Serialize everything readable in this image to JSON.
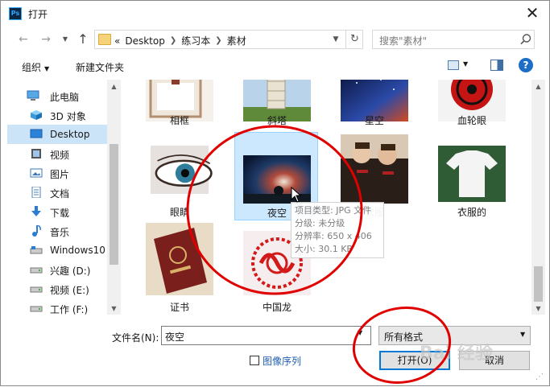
{
  "window": {
    "app_icon_label": "Ps",
    "title": "打开",
    "close_glyph": "✕"
  },
  "nav": {
    "back_glyph": "←",
    "forward_glyph": "→",
    "up_glyph": "↑",
    "breadcrumb_prefix": "«",
    "breadcrumbs": [
      "Desktop",
      "练习本",
      "素材"
    ],
    "refresh_glyph": "↻",
    "search_placeholder": "搜索\"素材\""
  },
  "toolbar": {
    "organize_label": "组织",
    "new_folder_label": "新建文件夹",
    "help_label": "?"
  },
  "sidebar": {
    "items": [
      {
        "label": "此电脑",
        "icon": "computer-icon"
      },
      {
        "label": "3D 对象",
        "icon": "3d-objects-icon"
      },
      {
        "label": "Desktop",
        "icon": "desktop-icon",
        "selected": true
      },
      {
        "label": "视频",
        "icon": "video-icon"
      },
      {
        "label": "图片",
        "icon": "pictures-icon"
      },
      {
        "label": "文档",
        "icon": "documents-icon"
      },
      {
        "label": "下载",
        "icon": "download-icon"
      },
      {
        "label": "音乐",
        "icon": "music-icon"
      },
      {
        "label": "Windows10",
        "icon": "drive-icon"
      },
      {
        "label": "兴趣 (D:)",
        "icon": "drive-icon"
      },
      {
        "label": "视频 (E:)",
        "icon": "drive-icon"
      },
      {
        "label": "工作 (F:)",
        "icon": "drive-icon"
      }
    ]
  },
  "files": [
    {
      "name": "相框"
    },
    {
      "name": "斜塔"
    },
    {
      "name": "星空"
    },
    {
      "name": "血轮眼"
    },
    {
      "name": "眼睛"
    },
    {
      "name": "夜空",
      "selected": true
    },
    {
      "name": "衣服"
    },
    {
      "name": "衣服的"
    },
    {
      "name": "证书"
    },
    {
      "name": "中国龙"
    }
  ],
  "tooltip": {
    "line1": "项目类型: JPG 文件",
    "line2": "分级: 未分级",
    "line3": "分辨率: 650 x 406",
    "line4": "大小: 30.1 KB"
  },
  "footer": {
    "filename_label": "文件名(N):",
    "filename_value": "夜空",
    "filetype_value": "所有格式",
    "image_sequence_label": "图像序列",
    "open_label": "打开(O)",
    "cancel_label": "取消"
  },
  "watermark": "Bai 经验",
  "colors": {
    "selection": "#cce8ff",
    "accent": "#0078d7",
    "annotation": "#e00000"
  }
}
